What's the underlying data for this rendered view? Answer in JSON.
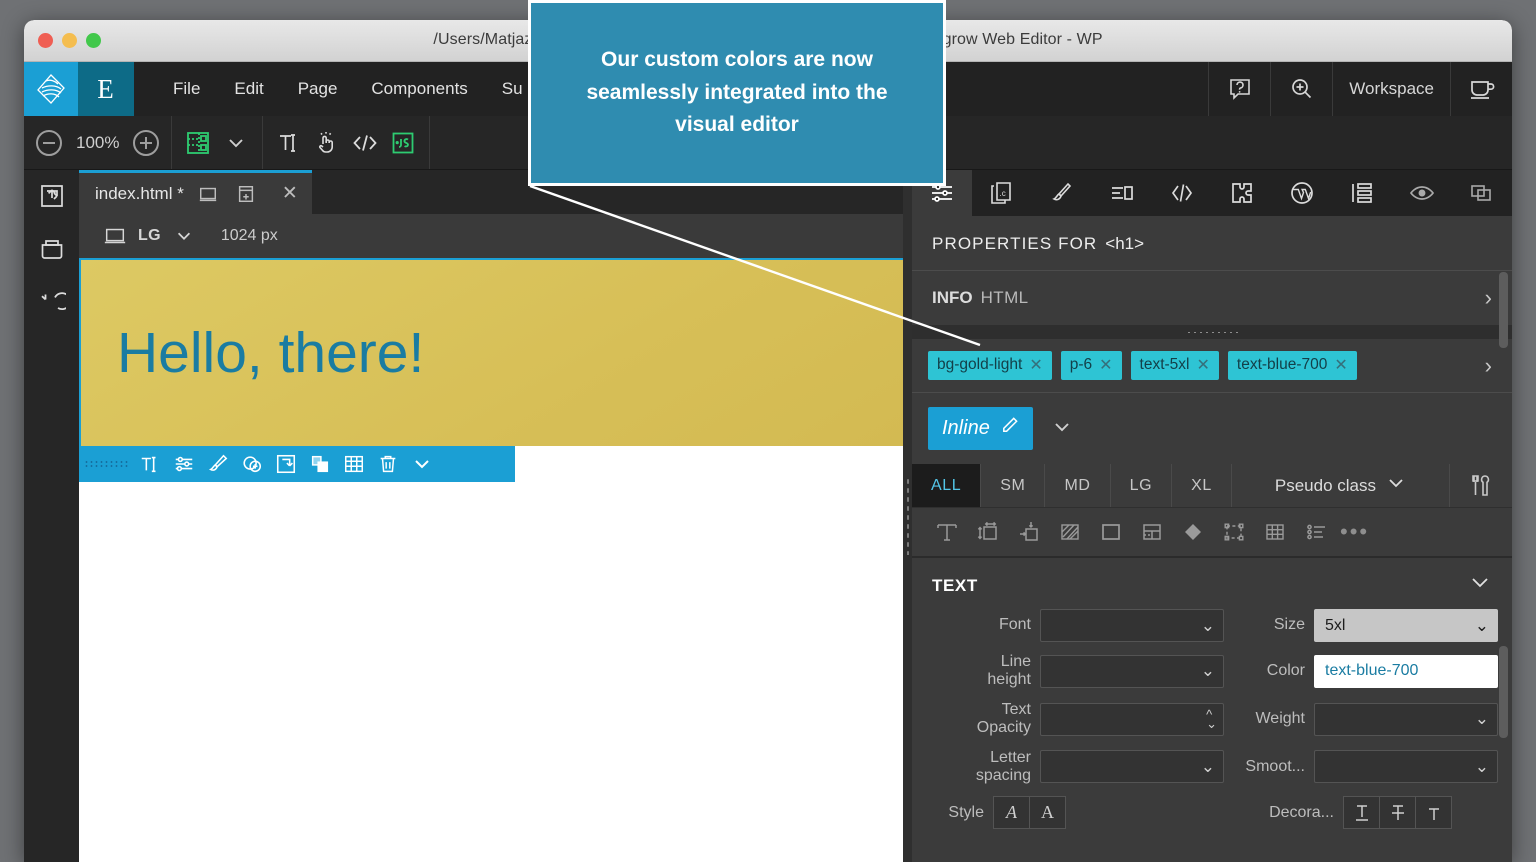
{
  "window": {
    "path_title": "/Users/Matjaz/P",
    "app_title": "grow Web Editor - WP"
  },
  "menubar": {
    "brand_icon": "pinegrow-logo-icon",
    "mode_letter": "E",
    "items": [
      {
        "label": "File"
      },
      {
        "label": "Edit"
      },
      {
        "label": "Page"
      },
      {
        "label": "Components"
      },
      {
        "label": "Su"
      }
    ],
    "right_items": [
      {
        "label": "",
        "icon": "help-bubble-icon"
      },
      {
        "label": "",
        "icon": "zoom-in-icon"
      },
      {
        "label": "Workspace",
        "icon": ""
      },
      {
        "label": "",
        "icon": "coffee-cup-icon"
      }
    ]
  },
  "toolbar": {
    "zoom_out_icon": "minus-circle-icon",
    "zoom_level": "100%",
    "zoom_in_icon": "plus-circle-icon",
    "device_icon": "responsive-frame-icon",
    "device_caret": "chevron-down-icon",
    "text_tool_icon": "text-cursor-icon",
    "hand_tool_icon": "hand-tap-icon",
    "code_tool_icon": "code-brackets-icon",
    "js_tool_icon": "js-script-icon"
  },
  "rail": {
    "items": [
      {
        "icon": "open-in-frame-icon"
      },
      {
        "icon": "archive-box-icon"
      },
      {
        "icon": "undo-arrow-icon"
      }
    ]
  },
  "editor": {
    "tab": {
      "filename": "index.html *",
      "preview_icon": "browser-preview-icon",
      "new_window_icon": "new-window-icon",
      "close_icon": "close-icon"
    },
    "breakpoint": {
      "device_icon": "laptop-icon",
      "name": "LG",
      "caret": "chevron-down-icon",
      "width": "1024 px"
    },
    "page": {
      "heading": "Hello, there!",
      "banner_color": "#d9c45c",
      "heading_color": "#1a7ca2",
      "selection_color": "#1b9fd4"
    },
    "element_toolbar": {
      "grip_icon": "drag-grip-icon",
      "items": [
        {
          "icon": "text-edit-icon"
        },
        {
          "icon": "properties-sliders-icon"
        },
        {
          "icon": "paint-brush-icon"
        },
        {
          "icon": "add-element-icon"
        },
        {
          "icon": "move-into-icon"
        },
        {
          "icon": "duplicate-icon"
        },
        {
          "icon": "grid-table-icon"
        },
        {
          "icon": "trash-icon"
        },
        {
          "icon": "chevron-down-icon"
        }
      ]
    }
  },
  "properties": {
    "tabs": [
      {
        "icon": "sliders-properties-icon",
        "active": true
      },
      {
        "icon": "css-file-icon",
        "active": false
      },
      {
        "icon": "brush-style-icon",
        "active": false
      },
      {
        "icon": "attributes-list-icon",
        "active": false
      },
      {
        "icon": "code-brackets-icon",
        "active": false
      },
      {
        "icon": "plugin-puzzle-icon",
        "active": false
      },
      {
        "icon": "wordpress-icon",
        "active": false
      },
      {
        "icon": "page-structure-icon",
        "active": false
      }
    ],
    "tabs_right": [
      {
        "icon": "eye-visibility-icon"
      },
      {
        "icon": "copy-panels-icon"
      }
    ],
    "header_label": "PROPERTIES FOR",
    "header_tag": "<h1>",
    "info_row": {
      "label": "INFO",
      "sub": "HTML",
      "chevron": "chevron-right-icon"
    },
    "classes": [
      {
        "name": "bg-gold-light",
        "remove_icon": "close-icon"
      },
      {
        "name": "p-6",
        "remove_icon": "close-icon"
      },
      {
        "name": "text-5xl",
        "remove_icon": "close-icon"
      },
      {
        "name": "text-blue-700",
        "remove_icon": "close-icon"
      }
    ],
    "classes_more_icon": "chevron-right-icon",
    "inline": {
      "label": "Inline",
      "edit_icon": "pencil-icon",
      "caret": "chevron-down-icon"
    },
    "breakpoint_tabs": [
      {
        "label": "ALL",
        "active": true
      },
      {
        "label": "SM",
        "active": false
      },
      {
        "label": "MD",
        "active": false
      },
      {
        "label": "LG",
        "active": false
      },
      {
        "label": "XL",
        "active": false
      }
    ],
    "pseudo_class": {
      "label": "Pseudo class",
      "caret": "chevron-down-icon"
    },
    "tools_icon": "wrench-tools-icon",
    "category_icons": [
      {
        "icon": "typography-icon"
      },
      {
        "icon": "sizing-icon"
      },
      {
        "icon": "spacing-icon"
      },
      {
        "icon": "background-icon"
      },
      {
        "icon": "border-icon"
      },
      {
        "icon": "layout-icon"
      },
      {
        "icon": "effects-icon"
      },
      {
        "icon": "transform-icon"
      },
      {
        "icon": "grid-icon"
      },
      {
        "icon": "list-icon"
      },
      {
        "icon": "more-dots-icon"
      }
    ],
    "text_section": {
      "title": "TEXT",
      "collapse_icon": "chevron-down-icon",
      "fields": [
        {
          "label": "Font",
          "value": "",
          "kind": "select"
        },
        {
          "label": "Size",
          "value": "5xl",
          "kind": "select-filled"
        },
        {
          "label": "Line\nheight",
          "value": "",
          "kind": "select"
        },
        {
          "label": "Color",
          "value": "text-blue-700",
          "kind": "select-white"
        },
        {
          "label": "Text\nOpacity",
          "value": "",
          "kind": "spinner"
        },
        {
          "label": "Weight",
          "value": "",
          "kind": "select"
        },
        {
          "label": "Letter\nspacing",
          "value": "",
          "kind": "select"
        },
        {
          "label": "Smoot...",
          "value": "",
          "kind": "select"
        }
      ],
      "style_label": "Style",
      "style_buttons": [
        {
          "glyph": "A",
          "name": "italic-button"
        },
        {
          "glyph": "A",
          "name": "normal-button"
        }
      ],
      "decoration_label": "Decora...",
      "decoration_buttons": [
        {
          "name": "underline-button"
        },
        {
          "name": "strikethrough-button"
        },
        {
          "name": "overline-button"
        }
      ]
    }
  },
  "callout": {
    "text": "Our custom colors are now seamlessly integrated into the visual editor",
    "background": "#2f8cb0",
    "border": "#ffffff"
  }
}
